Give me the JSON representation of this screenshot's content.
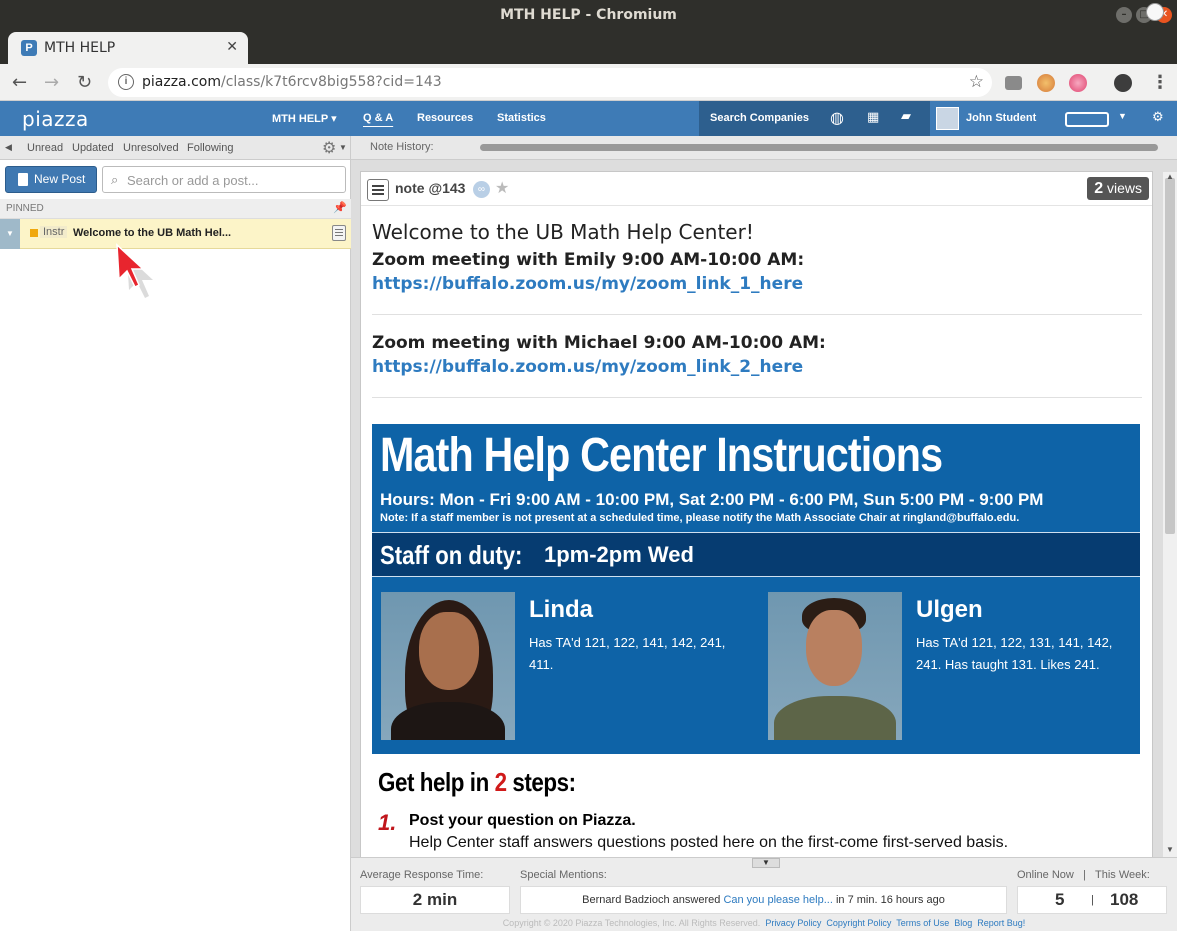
{
  "window": {
    "title": "MTH HELP - Chromium"
  },
  "browser": {
    "tab_title": "MTH HELP",
    "tab_favicon": "P",
    "url_host": "piazza.com",
    "url_path": "/class/k7t6rcv8big558?cid=143"
  },
  "piazza_nav": {
    "logo": "piazza",
    "class_menu": "MTH HELP ▾",
    "qa": "Q & A",
    "resources": "Resources",
    "statistics": "Statistics",
    "search_companies": "Search Companies",
    "user_name": "John Student"
  },
  "filters": {
    "unread": "Unread",
    "updated": "Updated",
    "unresolved": "Unresolved",
    "following": "Following"
  },
  "note_history_label": "Note History:",
  "sidebar": {
    "new_post": "New Post",
    "search_placeholder": "Search or add a post...",
    "pinned_label": "PINNED",
    "pinned_tag": "Instr",
    "pinned_title": "Welcome to the UB Math Hel..."
  },
  "note": {
    "type_label": "note @143",
    "views_count": "2",
    "views_label": "views",
    "heading": "Welcome to the UB Math Help Center!",
    "meeting1": "Zoom meeting with Emily 9:00 AM-10:00 AM:",
    "link1": "https://buffalo.zoom.us/my/zoom_link_1_here",
    "meeting2": "Zoom meeting with Michael 9:00 AM-10:00 AM:",
    "link2": "https://buffalo.zoom.us/my/zoom_link_2_here"
  },
  "poster": {
    "title": "Math Help Center Instructions",
    "hours": "Hours:  Mon - Fri 9:00 AM - 10:00 PM, Sat 2:00 PM - 6:00 PM, Sun 5:00 PM - 9:00 PM",
    "note": "Note:  If a staff member is not present at a scheduled time, please notify the Math Associate Chair at  ringland@buffalo.edu.",
    "staff_label": "Staff on duty:",
    "staff_time": "1pm-2pm Wed",
    "staff": [
      {
        "name": "Linda",
        "desc": "Has TA'd 121, 122, 141, 142, 241, 411."
      },
      {
        "name": "Ulgen",
        "desc": "Has TA'd 121, 122, 131, 141, 142, 241. Has taught 131. Likes 241."
      }
    ]
  },
  "steps": {
    "title_pre": "Get help in ",
    "title_num": "2",
    "title_post": " steps:",
    "step1_num": "1.",
    "step1_title": "Post your question on Piazza.",
    "step1_desc": "Help Center staff answers questions posted here on the first-come first-served basis."
  },
  "footer": {
    "avg_label": "Average Response Time:",
    "avg_value": "2 min",
    "mentions_label": "Special Mentions:",
    "mention_user": "Bernard Badzioch answered",
    "mention_link": "Can you please help...",
    "mention_time": "in 7 min. 16 hours ago",
    "online_label": "Online Now",
    "week_label": "This Week:",
    "online_value": "5",
    "week_value": "108",
    "copyright": "Copyright © 2020 Piazza Technologies, Inc. All Rights Reserved.",
    "links": [
      "Privacy Policy",
      "Copyright Policy",
      "Terms of Use",
      "Blog",
      "Report Bug!"
    ]
  },
  "colors": {
    "piazza_blue": "#3e7bb6",
    "poster_blue": "#0e63a7",
    "link_blue": "#2e7bc0",
    "pinned_bg": "#fcf4c8"
  }
}
